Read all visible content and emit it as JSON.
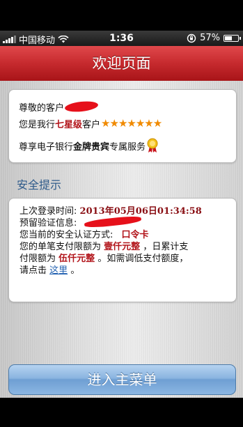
{
  "status_bar": {
    "carrier": "中国移动",
    "time": "1:36",
    "battery_percent_label": "57%",
    "battery_level": 0.57
  },
  "header": {
    "title": "欢迎页面"
  },
  "welcome_card": {
    "greeting": "尊敬的客户",
    "level_prefix": "您是我行",
    "level_value": "七星级",
    "level_suffix": "客户",
    "stars": "★★★★★★★",
    "service_prefix": "尊享电子银行",
    "service_bold": "金牌贵宾",
    "service_suffix": "专属服务"
  },
  "security": {
    "section_title": "安全提示",
    "last_login_label": "上次登录时间:",
    "last_login_value": "2013年05月06日01:34:58",
    "verify_info_label": "预留验证信息:",
    "auth_method_label": "您当前的安全认证方式:",
    "auth_method_value": "口令卡",
    "limit_line1_a": "您的单笔支付限额为",
    "single_limit": "壹仟元整",
    "limit_line1_b": "，日累计支",
    "limit_line2_a": "付限额为",
    "daily_limit": "伍仟元整",
    "limit_line2_b": "。如需调低支付额度，",
    "click_prefix": "请点击",
    "click_link": "这里",
    "click_suffix": "。"
  },
  "footer": {
    "main_menu_button": "进入主菜单"
  },
  "colors": {
    "header_red": "#c62a2e",
    "accent_red": "#b2141a",
    "star_orange": "#f08a00",
    "link_blue": "#1f5fb0",
    "button_blue": "#8ab4e0",
    "section_blue": "#2e5a8a"
  }
}
